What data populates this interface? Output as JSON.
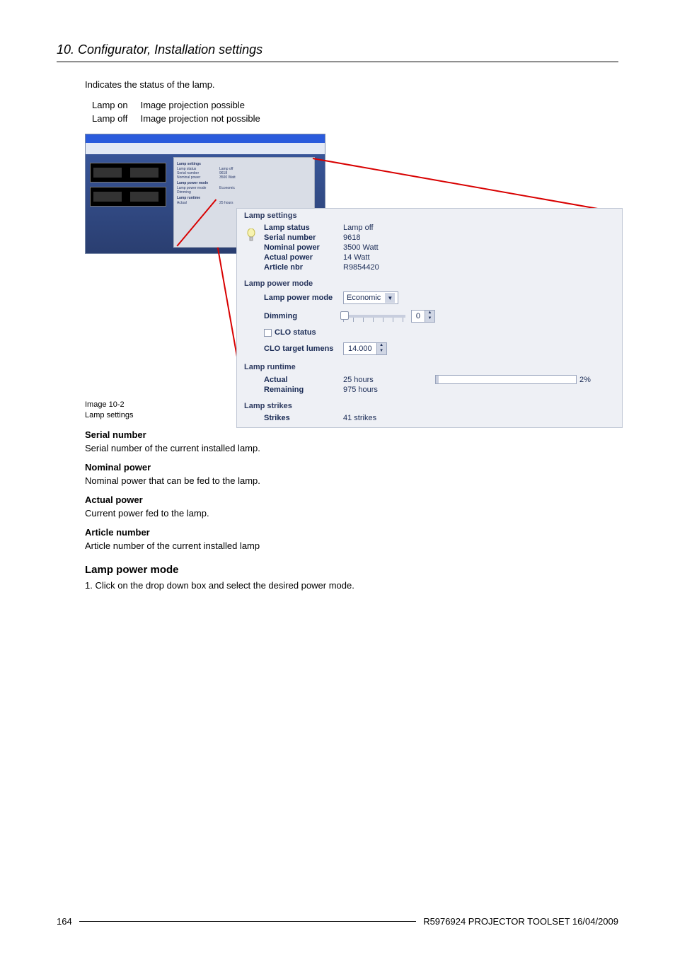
{
  "header": {
    "section": "10. Configurator, Installation settings"
  },
  "intro": {
    "indicates": "Indicates the status of the lamp."
  },
  "status_table": [
    {
      "state": "Lamp on",
      "meaning": "Image projection possible"
    },
    {
      "state": "Lamp off",
      "meaning": "Image projection not possible"
    }
  ],
  "lamp_panel": {
    "sections": {
      "settings": {
        "title": "Lamp settings",
        "rows": [
          {
            "k": "Lamp status",
            "v": "Lamp off"
          },
          {
            "k": "Serial number",
            "v": "9618"
          },
          {
            "k": "Nominal power",
            "v": "3500 Watt"
          },
          {
            "k": "Actual power",
            "v": "14 Watt"
          },
          {
            "k": "Article nbr",
            "v": "R9854420"
          }
        ]
      },
      "power_mode": {
        "title": "Lamp power mode",
        "mode_label": "Lamp power mode",
        "mode_value": "Economic",
        "dimming_label": "Dimming",
        "dimming_value": "0",
        "clo_status_label": "CLO status",
        "clo_target_label": "CLO target lumens",
        "clo_target_value": "14.000"
      },
      "runtime": {
        "title": "Lamp runtime",
        "actual_label": "Actual",
        "actual_value": "25 hours",
        "remaining_label": "Remaining",
        "remaining_value": "975 hours",
        "progress_text": "2%"
      },
      "strikes": {
        "title": "Lamp strikes",
        "strikes_label": "Strikes",
        "strikes_value": "41 strikes"
      }
    }
  },
  "caption": {
    "num": "Image 10-2",
    "label": "Lamp settings"
  },
  "serial": {
    "heading": "Serial number",
    "body": "Serial number of the current installed lamp."
  },
  "nominal": {
    "heading": "Nominal power",
    "body": "Nominal power that can be fed to the lamp."
  },
  "actual": {
    "heading": "Actual power",
    "body": "Current power fed to the lamp."
  },
  "article": {
    "heading": "Article number",
    "body": "Article number of the current installed lamp"
  },
  "mode_steps": {
    "heading": "Lamp power mode",
    "step1": "1. Click on the drop down box and select the desired power mode."
  },
  "footer": {
    "page": "164",
    "doc": "R5976924  PROJECTOR TOOLSET  16/04/2009"
  }
}
